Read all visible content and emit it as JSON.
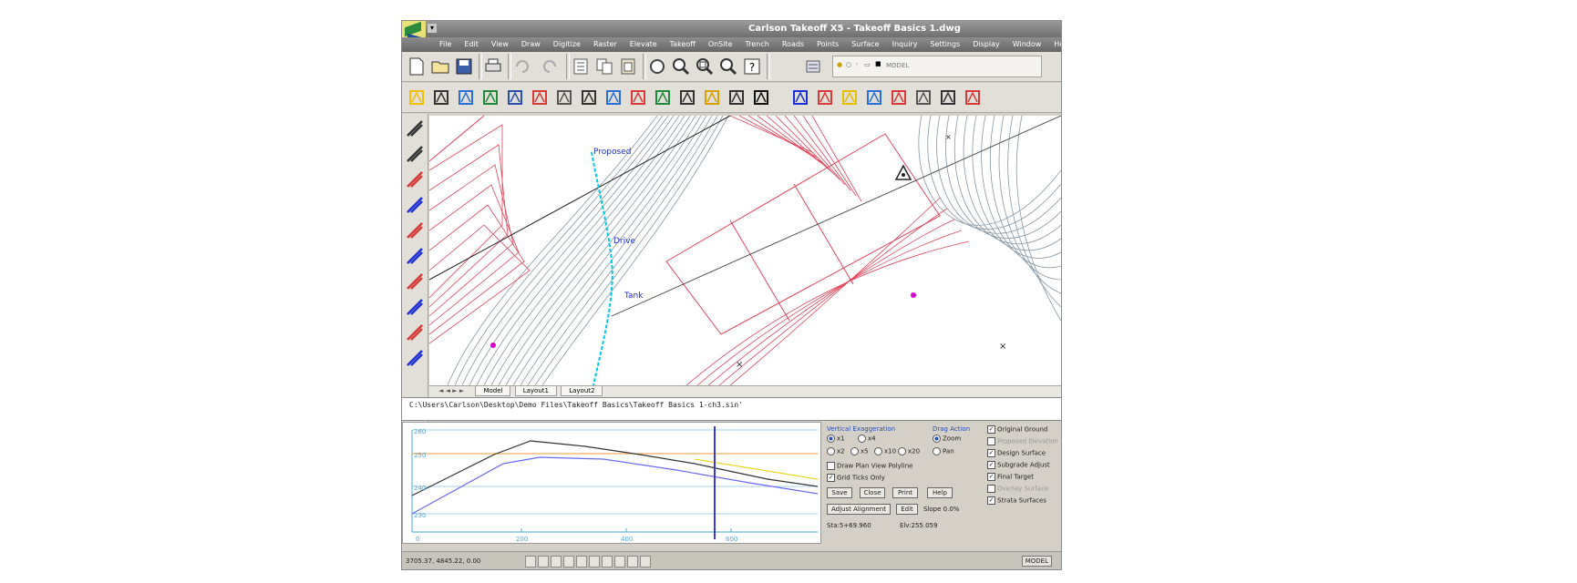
{
  "window": {
    "title": "Carlson Takeoff X5 - Takeoff Basics 1.dwg"
  },
  "menu": [
    "File",
    "Edit",
    "View",
    "Draw",
    "Digitize",
    "Raster",
    "Elevate",
    "Takeoff",
    "OnSite",
    "Trench",
    "Roads",
    "Points",
    "Surface",
    "Inquiry",
    "Settings",
    "Display",
    "Window",
    "Help"
  ],
  "layer_box": {
    "text": "MODEL"
  },
  "layout_tabs": {
    "model": "Model",
    "layout1": "Layout1",
    "layout2": "Layout2"
  },
  "drawing_labels": {
    "label1": "Proposed",
    "label2": "Drive",
    "label3": "Tank"
  },
  "command_line": "C:\\Users\\Carlson\\Desktop\\Demo Files\\Takeoff Basics\\Takeoff Basics 1-ch3.sin'",
  "profile": {
    "y_ticks": [
      "260",
      "250",
      "240",
      "230"
    ],
    "x_ticks": [
      "0",
      "200",
      "400",
      "600"
    ]
  },
  "controls": {
    "vert_exag_label": "Vertical Exaggeration",
    "vert_exag_options": [
      "x1",
      "x4",
      "x2",
      "x5",
      "x10",
      "x20"
    ],
    "drag_action_label": "Drag Action",
    "drag_action_options": [
      "Zoom",
      "Pan"
    ],
    "check_draw_plan": "Draw Plan View Polyline",
    "check_grid_ticks": "Grid Ticks Only",
    "buttons": [
      "Save",
      "Close",
      "Print",
      "Help"
    ],
    "adjust_button": "Adjust Alignment",
    "edit_button": "Edit",
    "slope": "Slope 0.0%",
    "station": "Sta:5+69.960",
    "elevation": "Elv:255.059",
    "surfaces": [
      "Original Ground",
      "Proposed Elevation",
      "Design Surface",
      "Subgrade Adjust",
      "Final Target",
      "Overlay Surface",
      "Strata Surfaces"
    ],
    "surfaces_checked": [
      true,
      false,
      true,
      true,
      true,
      false,
      true
    ]
  },
  "status": {
    "coords": "3705.37, 4845.22, 0.00",
    "mode": "MODEL"
  },
  "colors": {
    "contour_red": "#e0455a",
    "contour_gray": "#7a8c99",
    "label_magenta": "#d800c8",
    "cyan": "#00c8e8",
    "accent_blue": "#1a2fd8"
  }
}
